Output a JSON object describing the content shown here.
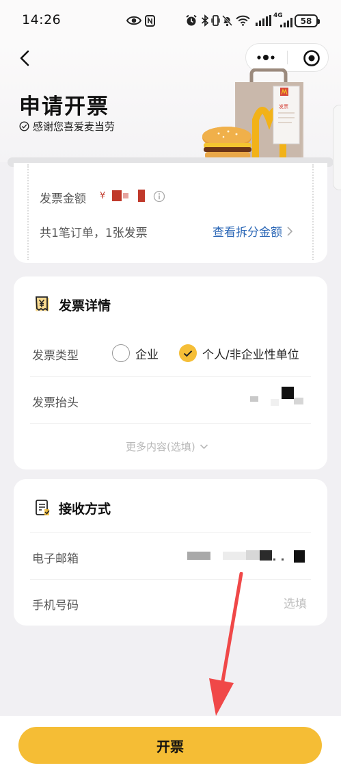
{
  "status_bar": {
    "time": "14:26",
    "battery": "58",
    "network": "4G",
    "icons": [
      "eye-icon",
      "nfc-icon",
      "alarm-icon",
      "bluetooth-icon",
      "vibrate-icon",
      "mute-icon",
      "wifi-icon",
      "signal-icon",
      "signal-4g-icon",
      "battery-icon"
    ]
  },
  "header": {
    "title": "申请开票",
    "subtitle": "感谢您喜爱麦当劳",
    "banner_bag_text": "发票",
    "icons": [
      "back-icon",
      "more-dots-icon",
      "target-icon",
      "check-circle-icon"
    ]
  },
  "amount_card": {
    "amount_label": "发票金额",
    "currency_symbol": "¥",
    "summary": "共1笔订单，1张发票",
    "split_link": "查看拆分金额",
    "icons": [
      "info-icon",
      "chevron-right-icon"
    ]
  },
  "invoice_details": {
    "title": "发票详情",
    "type_label": "发票类型",
    "type_options": [
      {
        "label": "企业",
        "selected": false
      },
      {
        "label": "个人/非企业性单位",
        "selected": true
      }
    ],
    "header_label": "发票抬头",
    "more_label": "更多内容(选填)",
    "icons": [
      "invoice-yen-icon",
      "chevron-down-icon"
    ]
  },
  "receive": {
    "title": "接收方式",
    "email_label": "电子邮箱",
    "phone_label": "手机号码",
    "phone_placeholder": "选填",
    "icons": [
      "receive-doc-icon"
    ]
  },
  "submit_label": "开票",
  "colors": {
    "accent": "#f5bd35",
    "link": "#2b67b6",
    "background": "#f1f0f3",
    "annotation_arrow": "#f04848"
  }
}
